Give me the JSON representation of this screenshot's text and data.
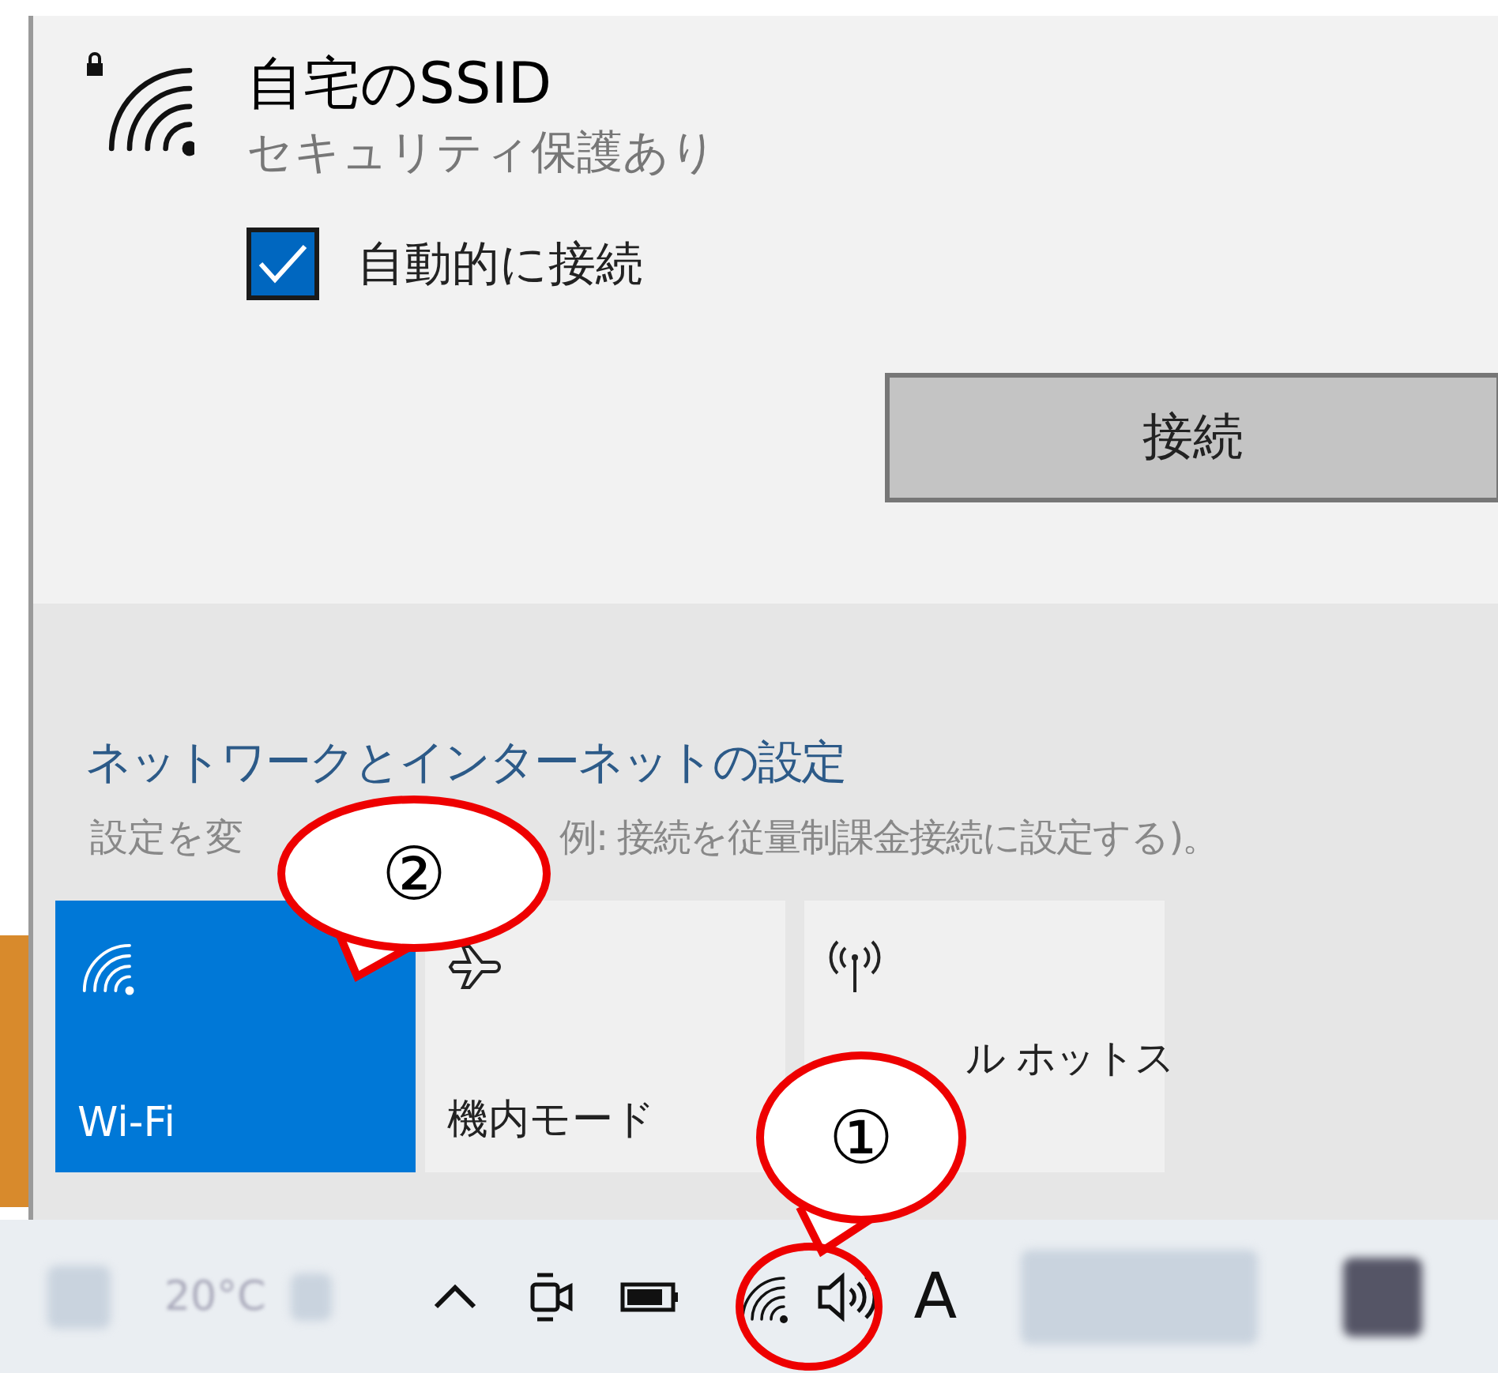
{
  "network": {
    "name": "自宅のSSID",
    "security": "セキュリティ保護あり",
    "auto_connect": {
      "label": "自動的に接続",
      "checked": true
    },
    "connect_button": "接続"
  },
  "settings": {
    "link": "ネットワークとインターネットの設定",
    "description_parts": [
      "設定を変",
      "例: 接続を従量制課金接続に設定する)。"
    ]
  },
  "tiles": [
    {
      "kind": "wifi",
      "label": "Wi-Fi",
      "on": true
    },
    {
      "kind": "airplane",
      "label": "機内モード",
      "on": false
    },
    {
      "kind": "hotspot",
      "label": "ル ホットス",
      "on": false
    }
  ],
  "taskbar": {
    "weather": "20°C",
    "ime": "A"
  },
  "annotations": [
    {
      "label": "②"
    },
    {
      "label": "①"
    }
  ]
}
